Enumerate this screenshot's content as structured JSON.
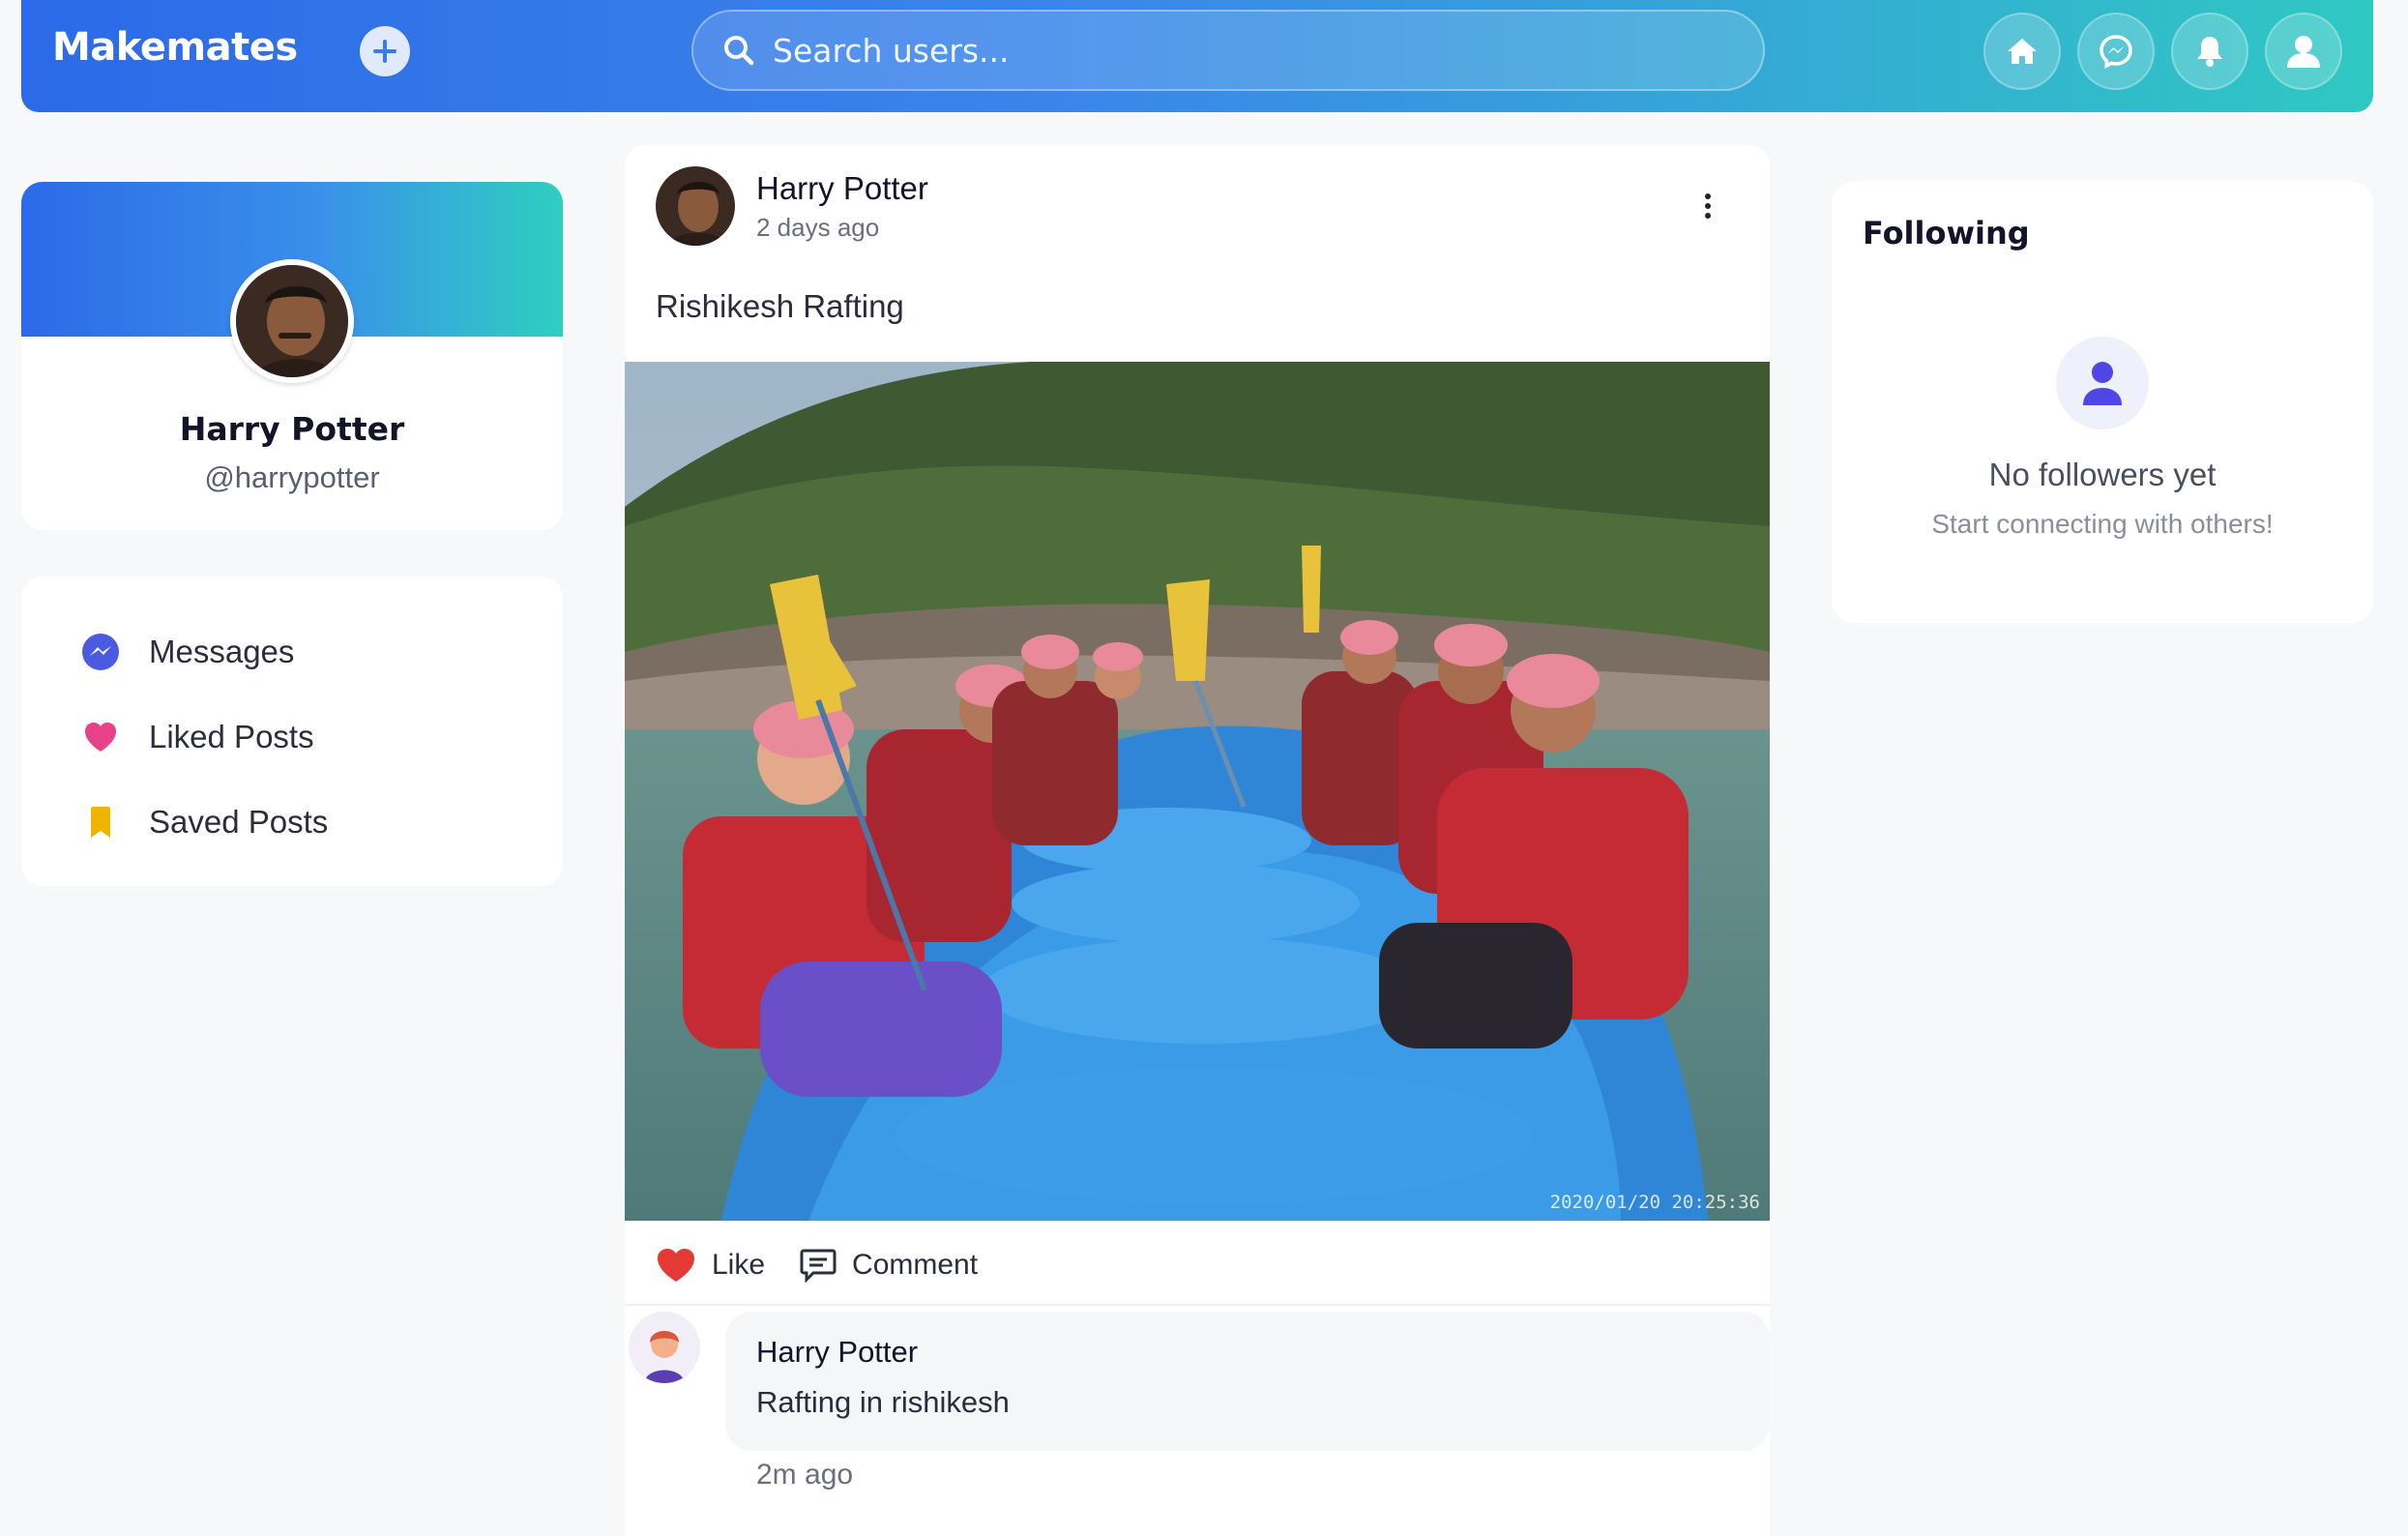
{
  "header": {
    "brand": "Makemates",
    "search_placeholder": "Search users...",
    "icons": [
      "plus-icon",
      "home-icon",
      "messenger-icon",
      "bell-icon",
      "user-icon"
    ]
  },
  "profile": {
    "name": "Harry Potter",
    "handle": "@harrypotter"
  },
  "menu": {
    "items": [
      {
        "label": "Messages",
        "icon": "messenger-icon",
        "color": "#4a5be0"
      },
      {
        "label": "Liked Posts",
        "icon": "heart-icon",
        "color": "#e8418a"
      },
      {
        "label": "Saved Posts",
        "icon": "bookmark-icon",
        "color": "#f0b400"
      }
    ]
  },
  "post": {
    "author": "Harry Potter",
    "time": "2 days ago",
    "text": "Rishikesh Rafting",
    "photo_stamp": "2020/01/20 20:25:36",
    "like_label": "Like",
    "comment_label": "Comment",
    "comment": {
      "author": "Harry Potter",
      "text": "Rafting in rishikesh",
      "time": "2m ago"
    }
  },
  "following": {
    "title": "Following",
    "empty_title": "No followers yet",
    "empty_sub": "Start connecting with others!"
  },
  "colors": {
    "accent": "#2c6ae8",
    "accent_end": "#2fc8c2",
    "like": "#e53935",
    "follow_icon": "#4f46e5"
  }
}
